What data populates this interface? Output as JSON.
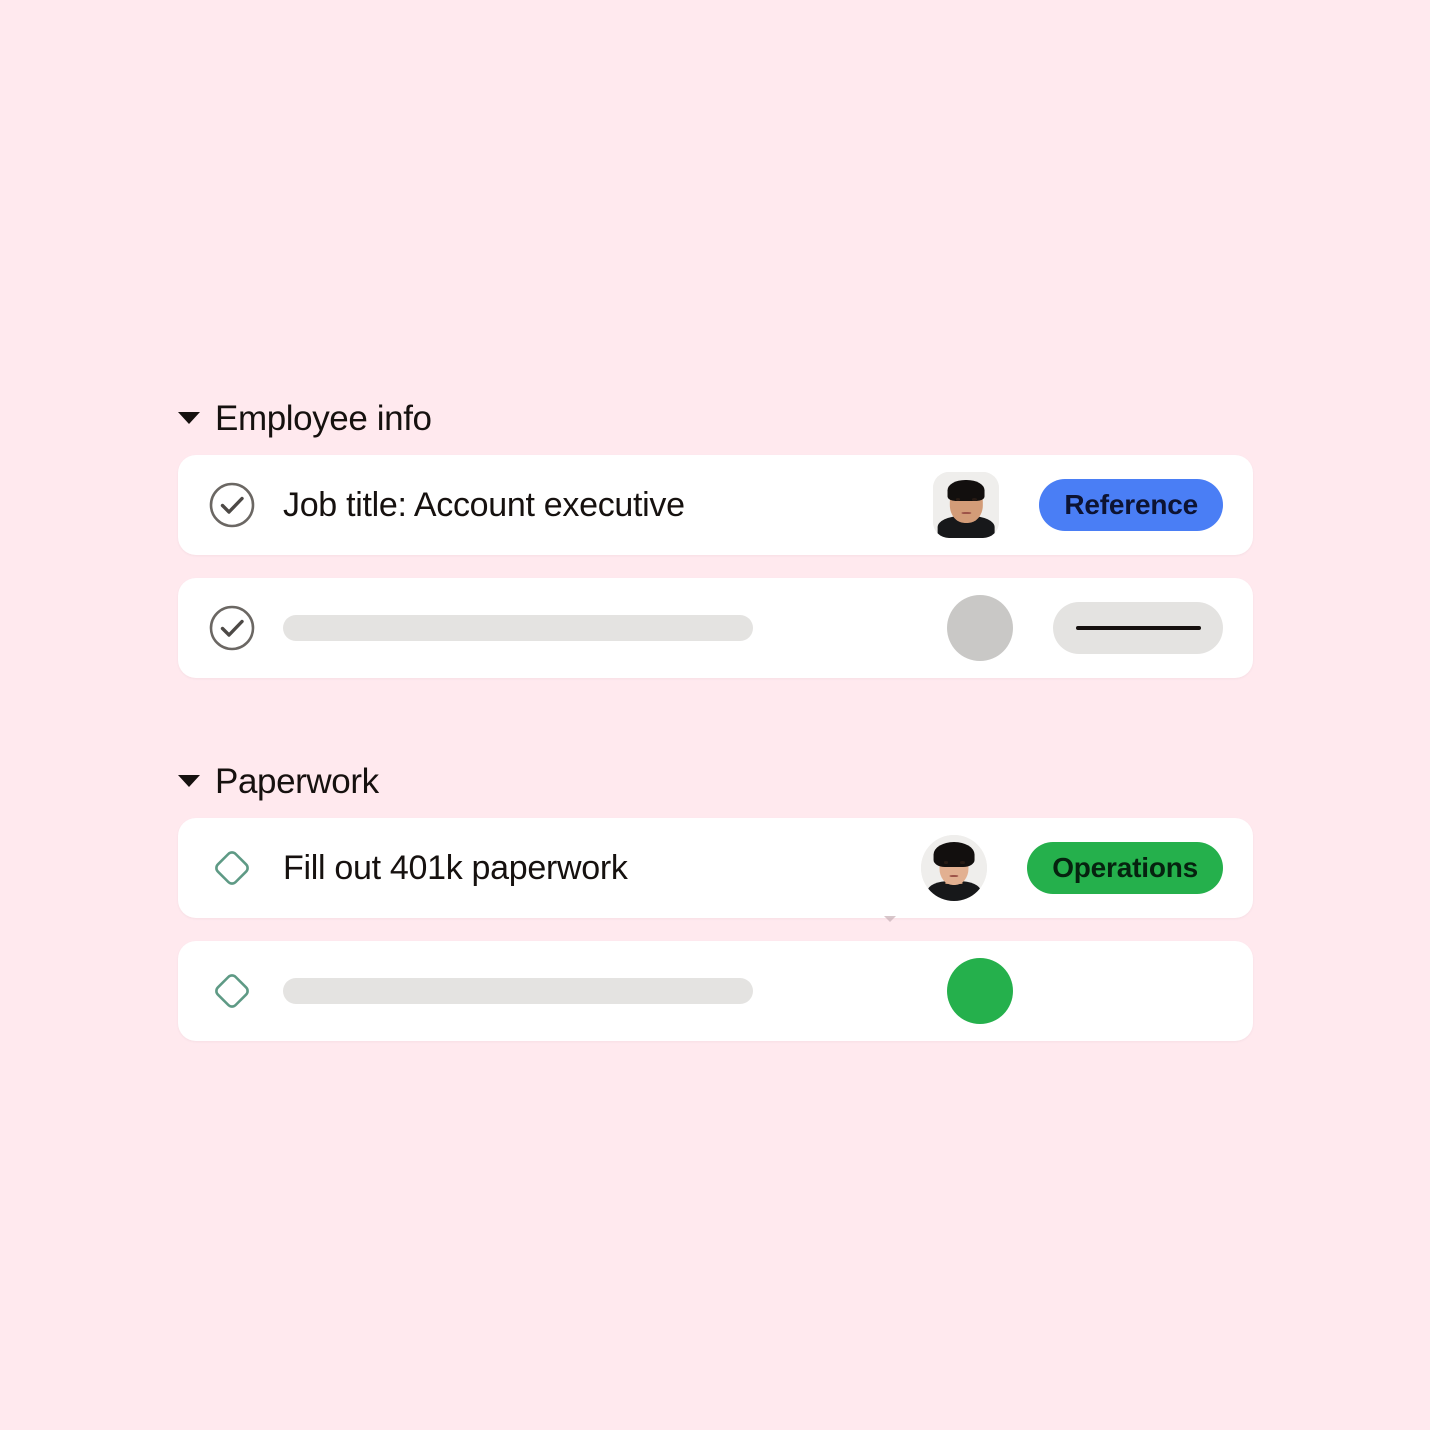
{
  "page": {
    "background_color": "#ffe9ee"
  },
  "sections": [
    {
      "id": "employee-info",
      "title": "Employee info",
      "caret_icon": "caret-down-icon",
      "expanded": true,
      "tasks": [
        {
          "id": "job-title",
          "status_icon": "check-circle-icon",
          "status_color": "#6b6763",
          "label": "Job title: Account executive",
          "is_placeholder": false,
          "avatar": {
            "name": "avatar",
            "shape": "rounded-square",
            "variant": "photo-male"
          },
          "badge": {
            "label": "Reference",
            "background_color": "#4a7ef5",
            "text_color": "#0d1332"
          }
        },
        {
          "id": "employee-info-placeholder",
          "status_icon": "check-circle-icon",
          "status_color": "#6b6763",
          "label": "",
          "is_placeholder": true,
          "avatar": {
            "name": "avatar-placeholder",
            "shape": "circle",
            "variant": "plain-grey",
            "color": "#c9c8c6"
          },
          "badge": {
            "label": "",
            "background_color": "#e4e3e1",
            "text_color": "#15100e",
            "is_placeholder": true
          }
        }
      ]
    },
    {
      "id": "paperwork",
      "title": "Paperwork",
      "caret_icon": "caret-down-icon",
      "expanded": true,
      "tasks": [
        {
          "id": "fill-out-401k",
          "status_icon": "diamond-icon",
          "status_color": "#5e9a85",
          "label": "Fill out 401k paperwork",
          "is_placeholder": false,
          "avatar": {
            "name": "avatar",
            "shape": "circle",
            "variant": "photo-female"
          },
          "badge": {
            "label": "Operations",
            "background_color": "#25b04c",
            "text_color": "#06220f"
          }
        },
        {
          "id": "paperwork-placeholder",
          "status_icon": "diamond-icon",
          "status_color": "#5e9a85",
          "label": "",
          "is_placeholder": true,
          "avatar": {
            "name": "avatar-placeholder",
            "shape": "circle",
            "variant": "plain-green",
            "color": "#25b04c"
          },
          "badge": {
            "label": "",
            "background_color": "",
            "text_color": "",
            "is_placeholder": false,
            "hidden": true
          }
        }
      ]
    }
  ]
}
